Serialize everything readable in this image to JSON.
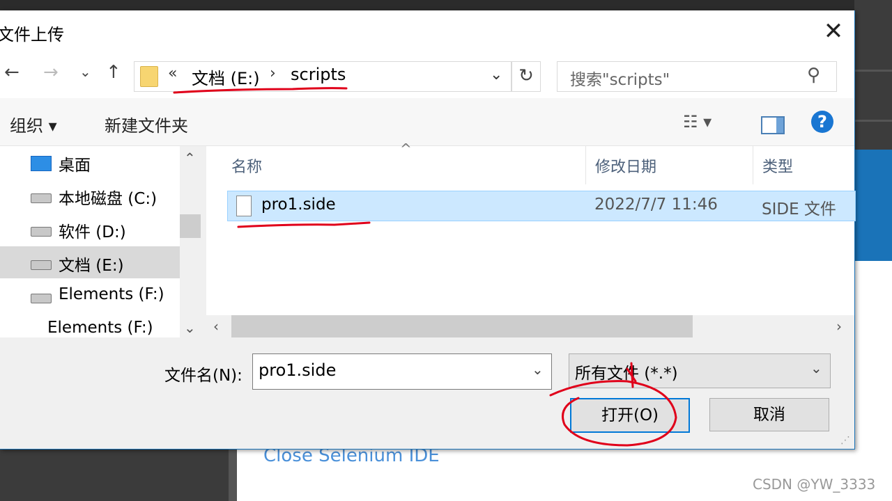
{
  "dialog": {
    "title": "文件上传",
    "close_glyph": "✕"
  },
  "nav": {
    "back": "←",
    "forward": "→",
    "recent": "⌄",
    "up": "↑",
    "breadcrumb_overflow": "«",
    "breadcrumb": [
      "文档 (E:)",
      "scripts"
    ],
    "breadcrumb_sep": "›",
    "dropdown": "⌄",
    "refresh": "↻"
  },
  "search": {
    "placeholder": "搜索\"scripts\"",
    "icon": "⚲"
  },
  "toolbar": {
    "organize": "组织 ▾",
    "new_folder": "新建文件夹",
    "view": "☷ ▾",
    "help": "?"
  },
  "tree": {
    "items": [
      {
        "label": "桌面",
        "icon": "desktop-icon"
      },
      {
        "label": "本地磁盘 (C:)",
        "icon": "windows-drive-icon"
      },
      {
        "label": "软件 (D:)",
        "icon": "drive-icon"
      },
      {
        "label": "文档 (E:)",
        "icon": "drive-icon",
        "selected": true
      },
      {
        "label": "Elements (F:)",
        "icon": "drive-icon"
      },
      {
        "label": "Elements (F:)",
        "icon": "drive-icon"
      }
    ],
    "scroll_up": "⌃",
    "scroll_down": "⌄"
  },
  "list": {
    "columns": [
      "名称",
      "修改日期",
      "类型"
    ],
    "sort_indicator": "^",
    "rows": [
      {
        "name": "pro1.side",
        "modified": "2022/7/7 11:46",
        "type": "SIDE 文件"
      }
    ],
    "scroll_left": "‹",
    "scroll_right": "›"
  },
  "footer": {
    "filename_label": "文件名(N):",
    "filename_value": "pro1.side",
    "filename_dropdown": "⌄",
    "filter_value": "所有文件 (*.*)",
    "filter_dropdown": "⌄",
    "open_button": "打开(O)",
    "cancel_button": "取消",
    "resize_grip": "⋰"
  },
  "background": {
    "close_link": "Close Selenium IDE",
    "watermark": "CSDN @YW_3333"
  },
  "colors": {
    "accent": "#0078d7",
    "selection": "#cce8ff",
    "annotation": "#e0001a"
  }
}
